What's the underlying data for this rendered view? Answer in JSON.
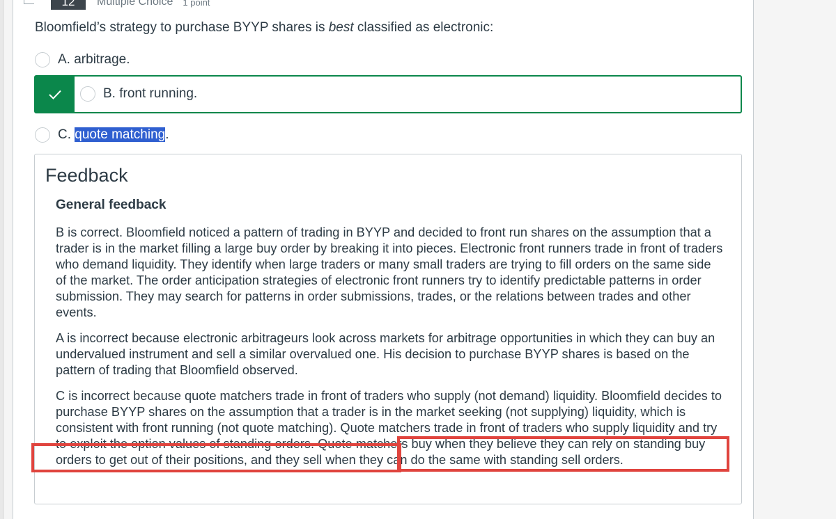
{
  "question": {
    "number": "12",
    "type": "Multiple Choice",
    "points": "1 point",
    "text_before": "Bloomfield’s strategy to purchase BYYP shares is ",
    "text_emphasis": "best",
    "text_after": " classified as electronic:"
  },
  "options": [
    {
      "label": "A. arbitrage."
    },
    {
      "label": "B. front running.",
      "correct": true
    },
    {
      "prefix": "C. ",
      "highlighted": "quote matching",
      "suffix": "."
    }
  ],
  "feedback": {
    "title": "Feedback",
    "subtitle": "General feedback",
    "paragraphs": [
      "B is correct. Bloomfield noticed a pattern of trading in BYYP and decided to front run shares on the assumption that a trader is in the market filling a large buy order by breaking it into pieces. Electronic front runners trade in front of traders who demand liquidity. They identify when large traders or many small traders are trying to fill orders on the same side of the market. The order anticipation strategies of electronic front runners try to identify predictable patterns in order submission. They may search for patterns in order submissions, trades, or the relations between trades and other events.",
      "A is incorrect because electronic arbitrageurs look across markets for arbitrage opportunities in which they can buy an undervalued instrument and sell a similar overvalued one. His decision to purchase BYYP shares is based on the pattern of trading that Bloomfield observed.",
      "C is incorrect because quote matchers trade in front of traders who supply (not demand) liquidity. Bloomfield decides to purchase BYYP shares on the assumption that a trader is in the market seeking (not supplying) liquidity, which is consistent with front running (not quote matching). Quote matchers trade in front of traders who supply liquidity and try to exploit the option values of standing orders. Quote matchers buy when they believe they can rely on standing buy orders to get out of their positions, and they sell when they can do the same with standing sell orders."
    ]
  },
  "colors": {
    "correct_green": "#0b874b",
    "highlight_blue": "#2f5fd0",
    "annotation_red": "#e0443e",
    "text": "#2d3b45"
  },
  "icons": {
    "correct": "checkmark-icon"
  }
}
